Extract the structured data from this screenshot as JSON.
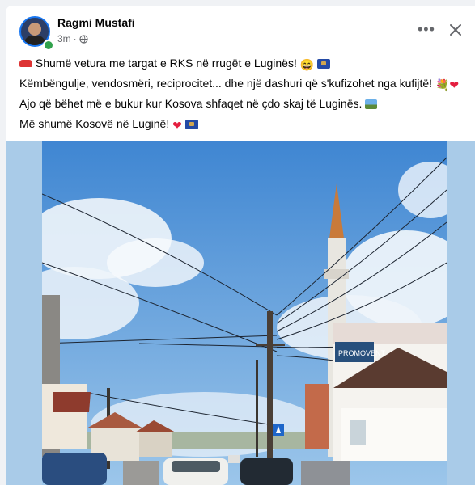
{
  "post": {
    "author": "Ragmi Mustafi",
    "time": "3m",
    "separator": "·",
    "privacy_icon": "globe-icon",
    "lines": [
      "Shumë vetura me targat e RKS në rrugët e Luginës!",
      "Këmbëngulje, vendosmëri, reciprocitet... dhe një dashuri që s'kufizohet nga kufijtë!",
      "Ajo që bëhet më e bukur kur Kosova shfaqet në çdo skaj të Luginës.",
      "Më shumë Kosovë në Luginë!"
    ],
    "emojis": [
      "car-emoji",
      "grin-emoji",
      "kosovo-flag-emoji",
      "sparkle-heart-emoji",
      "two-hearts-emoji",
      "landscape-emoji",
      "red-heart-emoji"
    ]
  },
  "header": {
    "more_label": "•••",
    "close_label": "✕"
  },
  "media": {
    "shop_sign": "PROMOVENT",
    "colors": {
      "sky": "#5a9bdc",
      "cloud": "#f4f8fc",
      "minaret": "#e8e6e0",
      "spire": "#c97a3a"
    }
  }
}
